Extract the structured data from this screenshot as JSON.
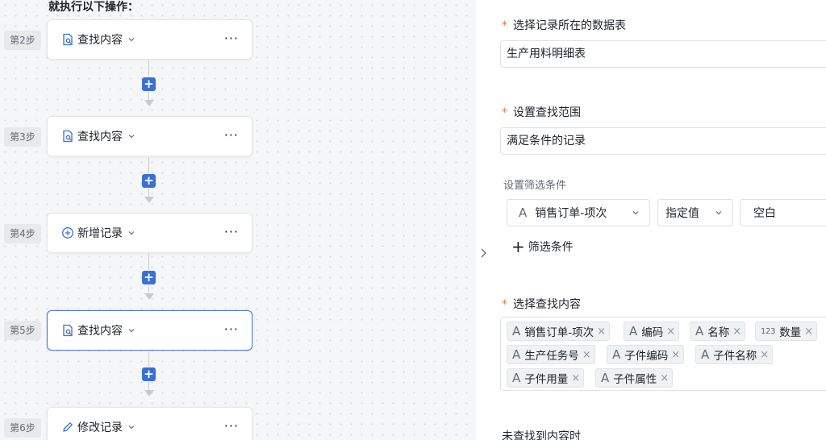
{
  "workflow": {
    "intro": "就执行以下操作：",
    "steps": [
      {
        "label": "第2步",
        "title": "查找内容",
        "icon": "find-record-icon"
      },
      {
        "label": "第3步",
        "title": "查找内容",
        "icon": "find-record-icon"
      },
      {
        "label": "第4步",
        "title": "新增记录",
        "icon": "add-circle-icon"
      },
      {
        "label": "第5步",
        "title": "查找内容",
        "icon": "find-record-icon",
        "active": true
      },
      {
        "label": "第6步",
        "title": "修改记录",
        "icon": "pencil-icon"
      }
    ],
    "more_label": "···",
    "plus_label": "+"
  },
  "panel": {
    "table_label": "选择记录所在的数据表",
    "table_value": "生产用料明细表",
    "range_label": "设置查找范围",
    "range_value": "满足条件的记录",
    "filter_label": "设置筛选条件",
    "filter": {
      "field_icon": "A",
      "field": "销售订单-项次",
      "operator": "指定值",
      "value": "空白"
    },
    "add_filter_label": "筛选条件",
    "add_filter_icon": "+",
    "content_label": "选择查找内容",
    "tags": [
      {
        "icon": "A",
        "label": "销售订单-项次"
      },
      {
        "icon": "A",
        "label": "编码"
      },
      {
        "icon": "A",
        "label": "名称"
      },
      {
        "icon": "123",
        "label": "数量"
      },
      {
        "icon": "A",
        "label": "生产任务号"
      },
      {
        "icon": "A",
        "label": "子件编码"
      },
      {
        "icon": "A",
        "label": "子件名称"
      },
      {
        "icon": "A",
        "label": "子件用量"
      },
      {
        "icon": "A",
        "label": "子件属性"
      }
    ],
    "tag_remove": "×",
    "not_found_label": "未查找到内容时"
  },
  "colors": {
    "accent": "#3b6fd8",
    "required": "#e07b39",
    "active_border": "#4e78e6"
  }
}
